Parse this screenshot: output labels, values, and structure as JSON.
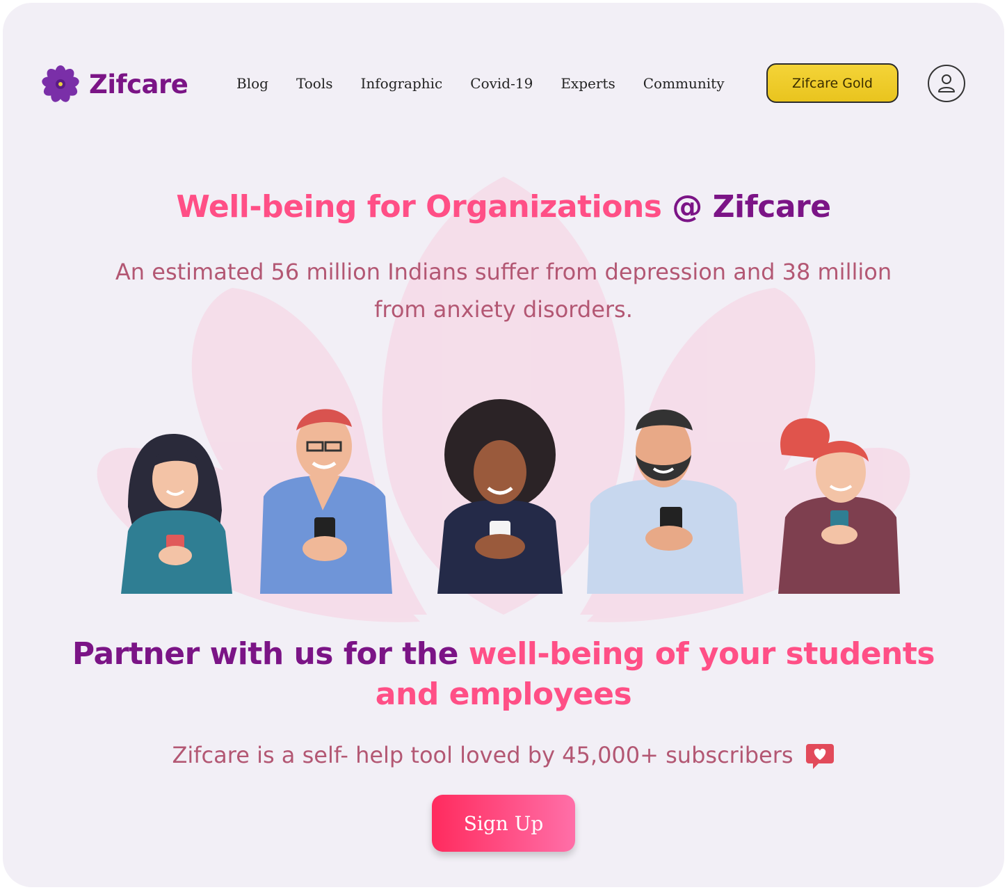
{
  "brand": {
    "name": "Zifcare"
  },
  "nav": {
    "items": [
      {
        "label": "Blog"
      },
      {
        "label": "Tools"
      },
      {
        "label": "Infographic"
      },
      {
        "label": "Covid-19"
      },
      {
        "label": "Experts"
      },
      {
        "label": "Community"
      }
    ],
    "gold_label": "Zifcare Gold"
  },
  "hero": {
    "title_part1": "Well-being for Organizations",
    "title_part2": " @ Zifcare",
    "subtitle": "An estimated 56 million Indians suffer from depression and 38 million from anxiety disorders."
  },
  "partner": {
    "title_part1": "Partner with us for the ",
    "title_part2": "well-being of your students and employees"
  },
  "tagline": "Zifcare is a self- help tool loved by 45,000+ subscribers",
  "cta": {
    "signup_label": "Sign Up"
  },
  "colors": {
    "brand_purple": "#7b1486",
    "accent_pink": "#ff4f86",
    "gold": "#f0cc2a",
    "cta_start": "#ff2b5e",
    "cta_end": "#ff6fa8",
    "body_text": "#b35773"
  },
  "icons": {
    "logo": "purple-flower-icon",
    "user": "user-icon",
    "tagline": "heart-chat-icon"
  }
}
